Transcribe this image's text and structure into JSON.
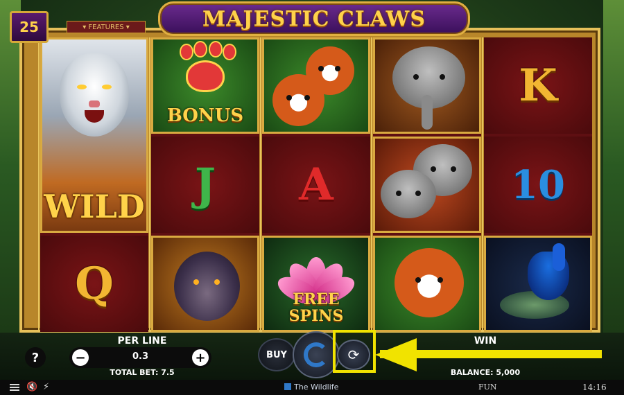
{
  "game": {
    "title": "MAJESTIC CLAWS",
    "lines": "25",
    "features_tab": "▾ FEATURES ▾"
  },
  "reels": [
    [
      {
        "symbol": "wild-tiger",
        "label": "WILD"
      },
      {
        "symbol": "letter-q",
        "label": "Q"
      }
    ],
    [
      {
        "symbol": "bonus-paw",
        "label": "BONUS"
      },
      {
        "symbol": "letter-j",
        "label": "J"
      },
      {
        "symbol": "bear",
        "label": ""
      }
    ],
    [
      {
        "symbol": "red-panda-pair",
        "label": ""
      },
      {
        "symbol": "letter-a",
        "label": "A"
      },
      {
        "symbol": "free-spins-lotus",
        "label": "FREE SPINS"
      }
    ],
    [
      {
        "symbol": "elephant",
        "label": ""
      },
      {
        "symbol": "elephant-pair",
        "label": ""
      },
      {
        "symbol": "red-panda",
        "label": ""
      }
    ],
    [
      {
        "symbol": "letter-k",
        "label": "K"
      },
      {
        "symbol": "number-10",
        "label": "10"
      },
      {
        "symbol": "peacock",
        "label": ""
      }
    ]
  ],
  "controls": {
    "help": "?",
    "per_line_label": "PER LINE",
    "per_line_value": "0.3",
    "minus": "−",
    "plus": "+",
    "total_bet": "TOTAL BET: 7.5",
    "buy": "BUY",
    "autoplay_glyph": "⟳",
    "win_label": "WIN",
    "balance": "BALANCE: 5,000"
  },
  "system_bar": {
    "provider": "The Wildlife",
    "mode": "FUN",
    "time": "14:16",
    "sound_glyph": "🔇",
    "turbo_glyph": "⚡"
  },
  "colors": {
    "highlight": "#f1e300",
    "title_gold": "#ffd24a",
    "spin_blue": "#2f78c8"
  }
}
